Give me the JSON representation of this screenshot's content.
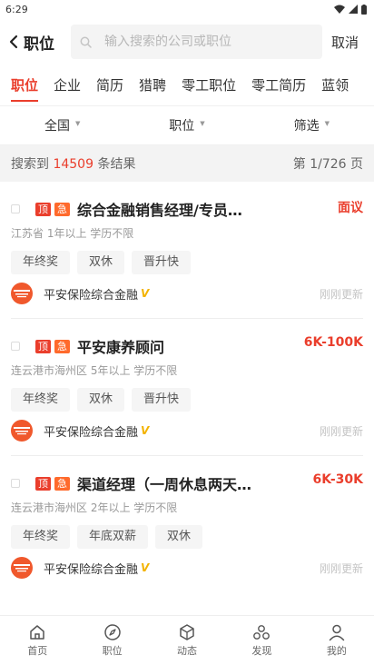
{
  "status": {
    "time": "6:29"
  },
  "header": {
    "back_label": "职位",
    "search_placeholder": "输入搜索的公司或职位",
    "cancel": "取消"
  },
  "tabs": [
    {
      "label": "职位",
      "active": true
    },
    {
      "label": "企业"
    },
    {
      "label": "简历"
    },
    {
      "label": "猎聘"
    },
    {
      "label": "零工职位"
    },
    {
      "label": "零工简历"
    },
    {
      "label": "蓝领"
    }
  ],
  "filters": [
    {
      "label": "全国"
    },
    {
      "label": "职位"
    },
    {
      "label": "筛选"
    }
  ],
  "results": {
    "prefix": "搜索到",
    "count": "14509",
    "suffix": "条结果",
    "page": "第 1/726 页"
  },
  "badges": {
    "top": "顶",
    "urgent": "急"
  },
  "jobs": [
    {
      "title": "综合金融销售经理/专员…",
      "salary": "面议",
      "meta": "江苏省 1年以上 学历不限",
      "tags": [
        "年终奖",
        "双休",
        "晋升快"
      ],
      "company": "平安保险综合金融",
      "updated": "刚刚更新"
    },
    {
      "title": "平安康养顾问",
      "salary": "6K-100K",
      "meta": "连云港市海州区 5年以上 学历不限",
      "tags": [
        "年终奖",
        "双休",
        "晋升快"
      ],
      "company": "平安保险综合金融",
      "updated": "刚刚更新"
    },
    {
      "title": "渠道经理（一周休息两天…",
      "salary": "6K-30K",
      "meta": "连云港市海州区 2年以上 学历不限",
      "tags": [
        "年终奖",
        "年底双薪",
        "双休"
      ],
      "company": "平安保险综合金融",
      "updated": "刚刚更新"
    }
  ],
  "nav": [
    {
      "label": "首页",
      "icon": "home-icon"
    },
    {
      "label": "职位",
      "icon": "compass-icon"
    },
    {
      "label": "动态",
      "icon": "cube-icon"
    },
    {
      "label": "发现",
      "icon": "discover-icon"
    },
    {
      "label": "我的",
      "icon": "person-icon"
    }
  ],
  "colors": {
    "accent": "#ea3e2c",
    "urgent": "#ff6a2c",
    "verified": "#f3b300"
  }
}
